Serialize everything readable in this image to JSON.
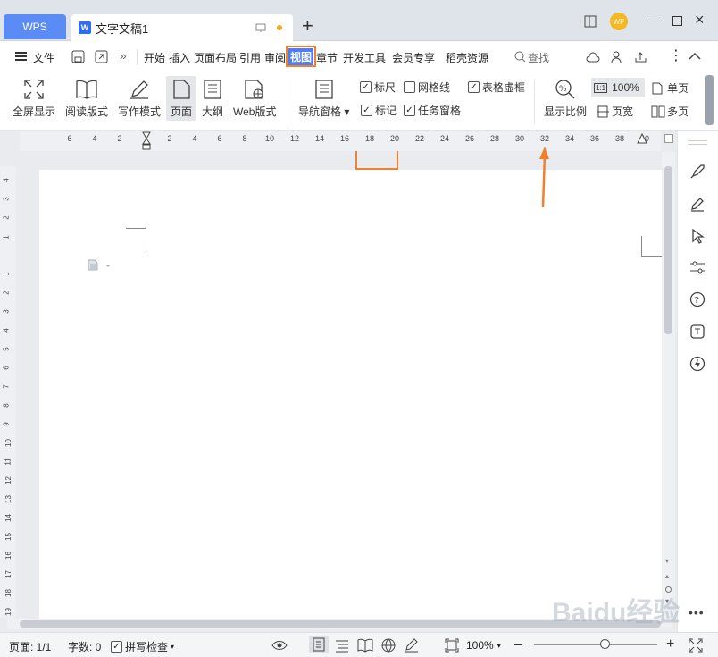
{
  "title_bar": {
    "app_tab": "WPS",
    "document_tab": "文字文稿1",
    "avatar_initials": "WP"
  },
  "menu": {
    "file": "文件",
    "items": [
      "开始",
      "插入",
      "页面布局",
      "引用",
      "审阅",
      "视图",
      "章节",
      "开发工具",
      "会员专享",
      "稻壳资源"
    ],
    "active": "视图",
    "search": "查找"
  },
  "ribbon": {
    "buttons": [
      "全屏显示",
      "阅读版式",
      "写作模式",
      "页面",
      "大纲",
      "Web版式",
      "导航窗格",
      "显示比例",
      "页宽",
      "单页",
      "多页"
    ],
    "zoom_value": "100%",
    "checkboxes": [
      {
        "label": "标尺",
        "checked": true
      },
      {
        "label": "网格线",
        "checked": false
      },
      {
        "label": "表格虚框",
        "checked": true
      },
      {
        "label": "标记",
        "checked": true
      },
      {
        "label": "任务窗格",
        "checked": true
      }
    ]
  },
  "ruler": {
    "horizontal": [
      "6",
      "4",
      "2",
      "2",
      "4",
      "6",
      "8",
      "10",
      "12",
      "14",
      "16",
      "18",
      "20",
      "22",
      "24",
      "26",
      "28",
      "30",
      "32",
      "34",
      "36",
      "38",
      "40"
    ],
    "vertical": [
      "4",
      "3",
      "2",
      "1",
      "1",
      "2",
      "3",
      "4",
      "5",
      "6",
      "7",
      "8",
      "9",
      "10",
      "11",
      "12",
      "13",
      "14",
      "15",
      "16",
      "17",
      "18",
      "19"
    ]
  },
  "annotation": {
    "color": "#f07f2e"
  },
  "status": {
    "page": "页面: 1/1",
    "words": "字数: 0",
    "spell": "拼写检查",
    "zoom": "100%",
    "zoom_level": 0.58
  },
  "watermark": "Baidu经验"
}
